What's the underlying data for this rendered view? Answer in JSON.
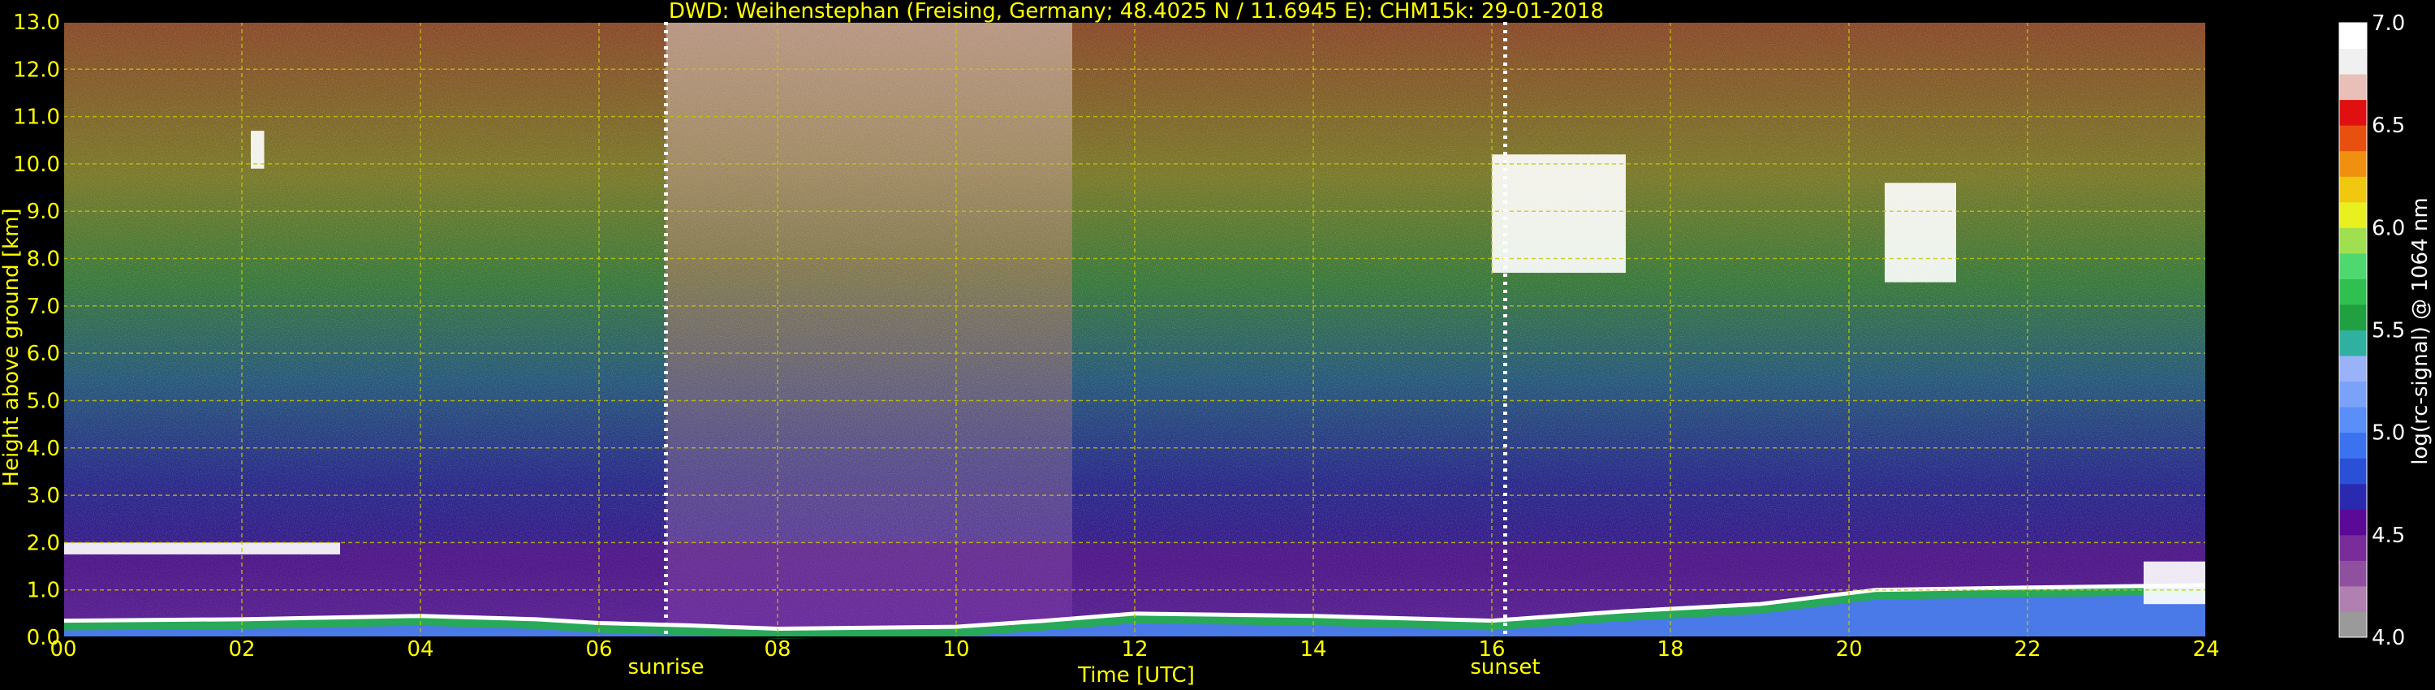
{
  "chart_data": {
    "type": "heatmap",
    "title": "DWD: Weihenstephan (Freising, Germany; 48.4025 N / 11.6945 E):    CHM15k: 29-01-2018",
    "xlabel": "Time [UTC]",
    "ylabel": "Height above ground [km]",
    "xlim": [
      0,
      24
    ],
    "ylim": [
      0,
      13
    ],
    "x_ticks": [
      "00",
      "02",
      "04",
      "06",
      "08",
      "10",
      "12",
      "14",
      "16",
      "18",
      "20",
      "22",
      "24"
    ],
    "y_ticks": [
      "0.0",
      "1.0",
      "2.0",
      "3.0",
      "4.0",
      "5.0",
      "6.0",
      "7.0",
      "8.0",
      "9.0",
      "10.0",
      "11.0",
      "12.0",
      "13.0"
    ],
    "grid": true,
    "colorbar": {
      "label": "log(rc-signal) @ 1064 nm",
      "range": [
        4.0,
        7.0
      ],
      "ticks": [
        "4.0",
        "4.5",
        "5.0",
        "5.5",
        "6.0",
        "6.5",
        "7.0"
      ],
      "colors": [
        "#9a9a9a",
        "#b080b0",
        "#9050a0",
        "#7a2c9a",
        "#5a0a96",
        "#2a2ab0",
        "#2a50d8",
        "#3a72f0",
        "#5a8ef8",
        "#7aa2f8",
        "#9ab2f8",
        "#30b0a0",
        "#20a040",
        "#30c050",
        "#50d870",
        "#a0e050",
        "#e8f020",
        "#f0c810",
        "#f09010",
        "#e85010",
        "#e01010",
        "#e8c0b8",
        "#f0f0f0",
        "#ffffff"
      ]
    },
    "events": [
      {
        "label": "sunrise",
        "time": 6.75
      },
      {
        "label": "sunset",
        "time": 16.15
      }
    ],
    "boundary_layer_km": [
      [
        0,
        0.35
      ],
      [
        2,
        0.38
      ],
      [
        4,
        0.45
      ],
      [
        5.3,
        0.38
      ],
      [
        6,
        0.3
      ],
      [
        7,
        0.25
      ],
      [
        8,
        0.18
      ],
      [
        10,
        0.22
      ],
      [
        11,
        0.35
      ],
      [
        12,
        0.5
      ],
      [
        14,
        0.45
      ],
      [
        16,
        0.35
      ],
      [
        17.5,
        0.55
      ],
      [
        19,
        0.7
      ],
      [
        20.3,
        1.0
      ],
      [
        22,
        1.05
      ],
      [
        24,
        1.1
      ]
    ],
    "cloud_layers_km": [
      {
        "start": 0,
        "end": 3.1,
        "base": 1.75,
        "top": 2.0
      },
      {
        "start": 2.1,
        "end": 2.25,
        "base": 9.9,
        "top": 10.7
      },
      {
        "start": 16.0,
        "end": 17.5,
        "base": 7.7,
        "top": 10.2
      },
      {
        "start": 20.4,
        "end": 21.2,
        "base": 7.5,
        "top": 9.6
      },
      {
        "start": 23.3,
        "end": 24,
        "base": 0.7,
        "top": 1.6
      }
    ]
  },
  "colors": {
    "text": "#ffff00",
    "grid": "#c8c800",
    "marker": "#ffffff"
  }
}
